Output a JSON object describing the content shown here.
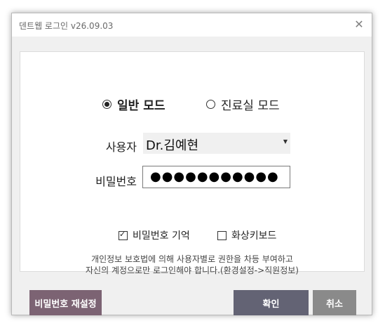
{
  "window": {
    "title": "덴트웹 로그인 v26.09.03",
    "close_glyph": "✕"
  },
  "modes": {
    "general": {
      "label": "일반 모드",
      "selected": true
    },
    "clinic": {
      "label": "진료실 모드",
      "selected": false
    }
  },
  "user": {
    "label": "사용자",
    "selected_value": "Dr.김예현",
    "dropdown_icon": "chevron-down-icon"
  },
  "password": {
    "label": "비밀번호",
    "masked_value": "●●●●●●●●●●●"
  },
  "options": {
    "remember_password": {
      "label": "비밀번호 기억",
      "checked": true,
      "check_glyph": "✓"
    },
    "virtual_keyboard": {
      "label": "화상키보드",
      "checked": false
    }
  },
  "notice": {
    "line1": "개인정보 보호법에 의해 사용자별로 권한을 차등 부여하고",
    "line2": "자신의 계정으로만 로그인해야 합니다.(환경설정->직원정보)"
  },
  "buttons": {
    "reset_password": "비밀번호 재설정",
    "confirm": "확인",
    "cancel": "취소"
  },
  "colors": {
    "reset_button": "#7c6373",
    "confirm_button": "#636374",
    "cancel_button": "#8a8a8a"
  }
}
